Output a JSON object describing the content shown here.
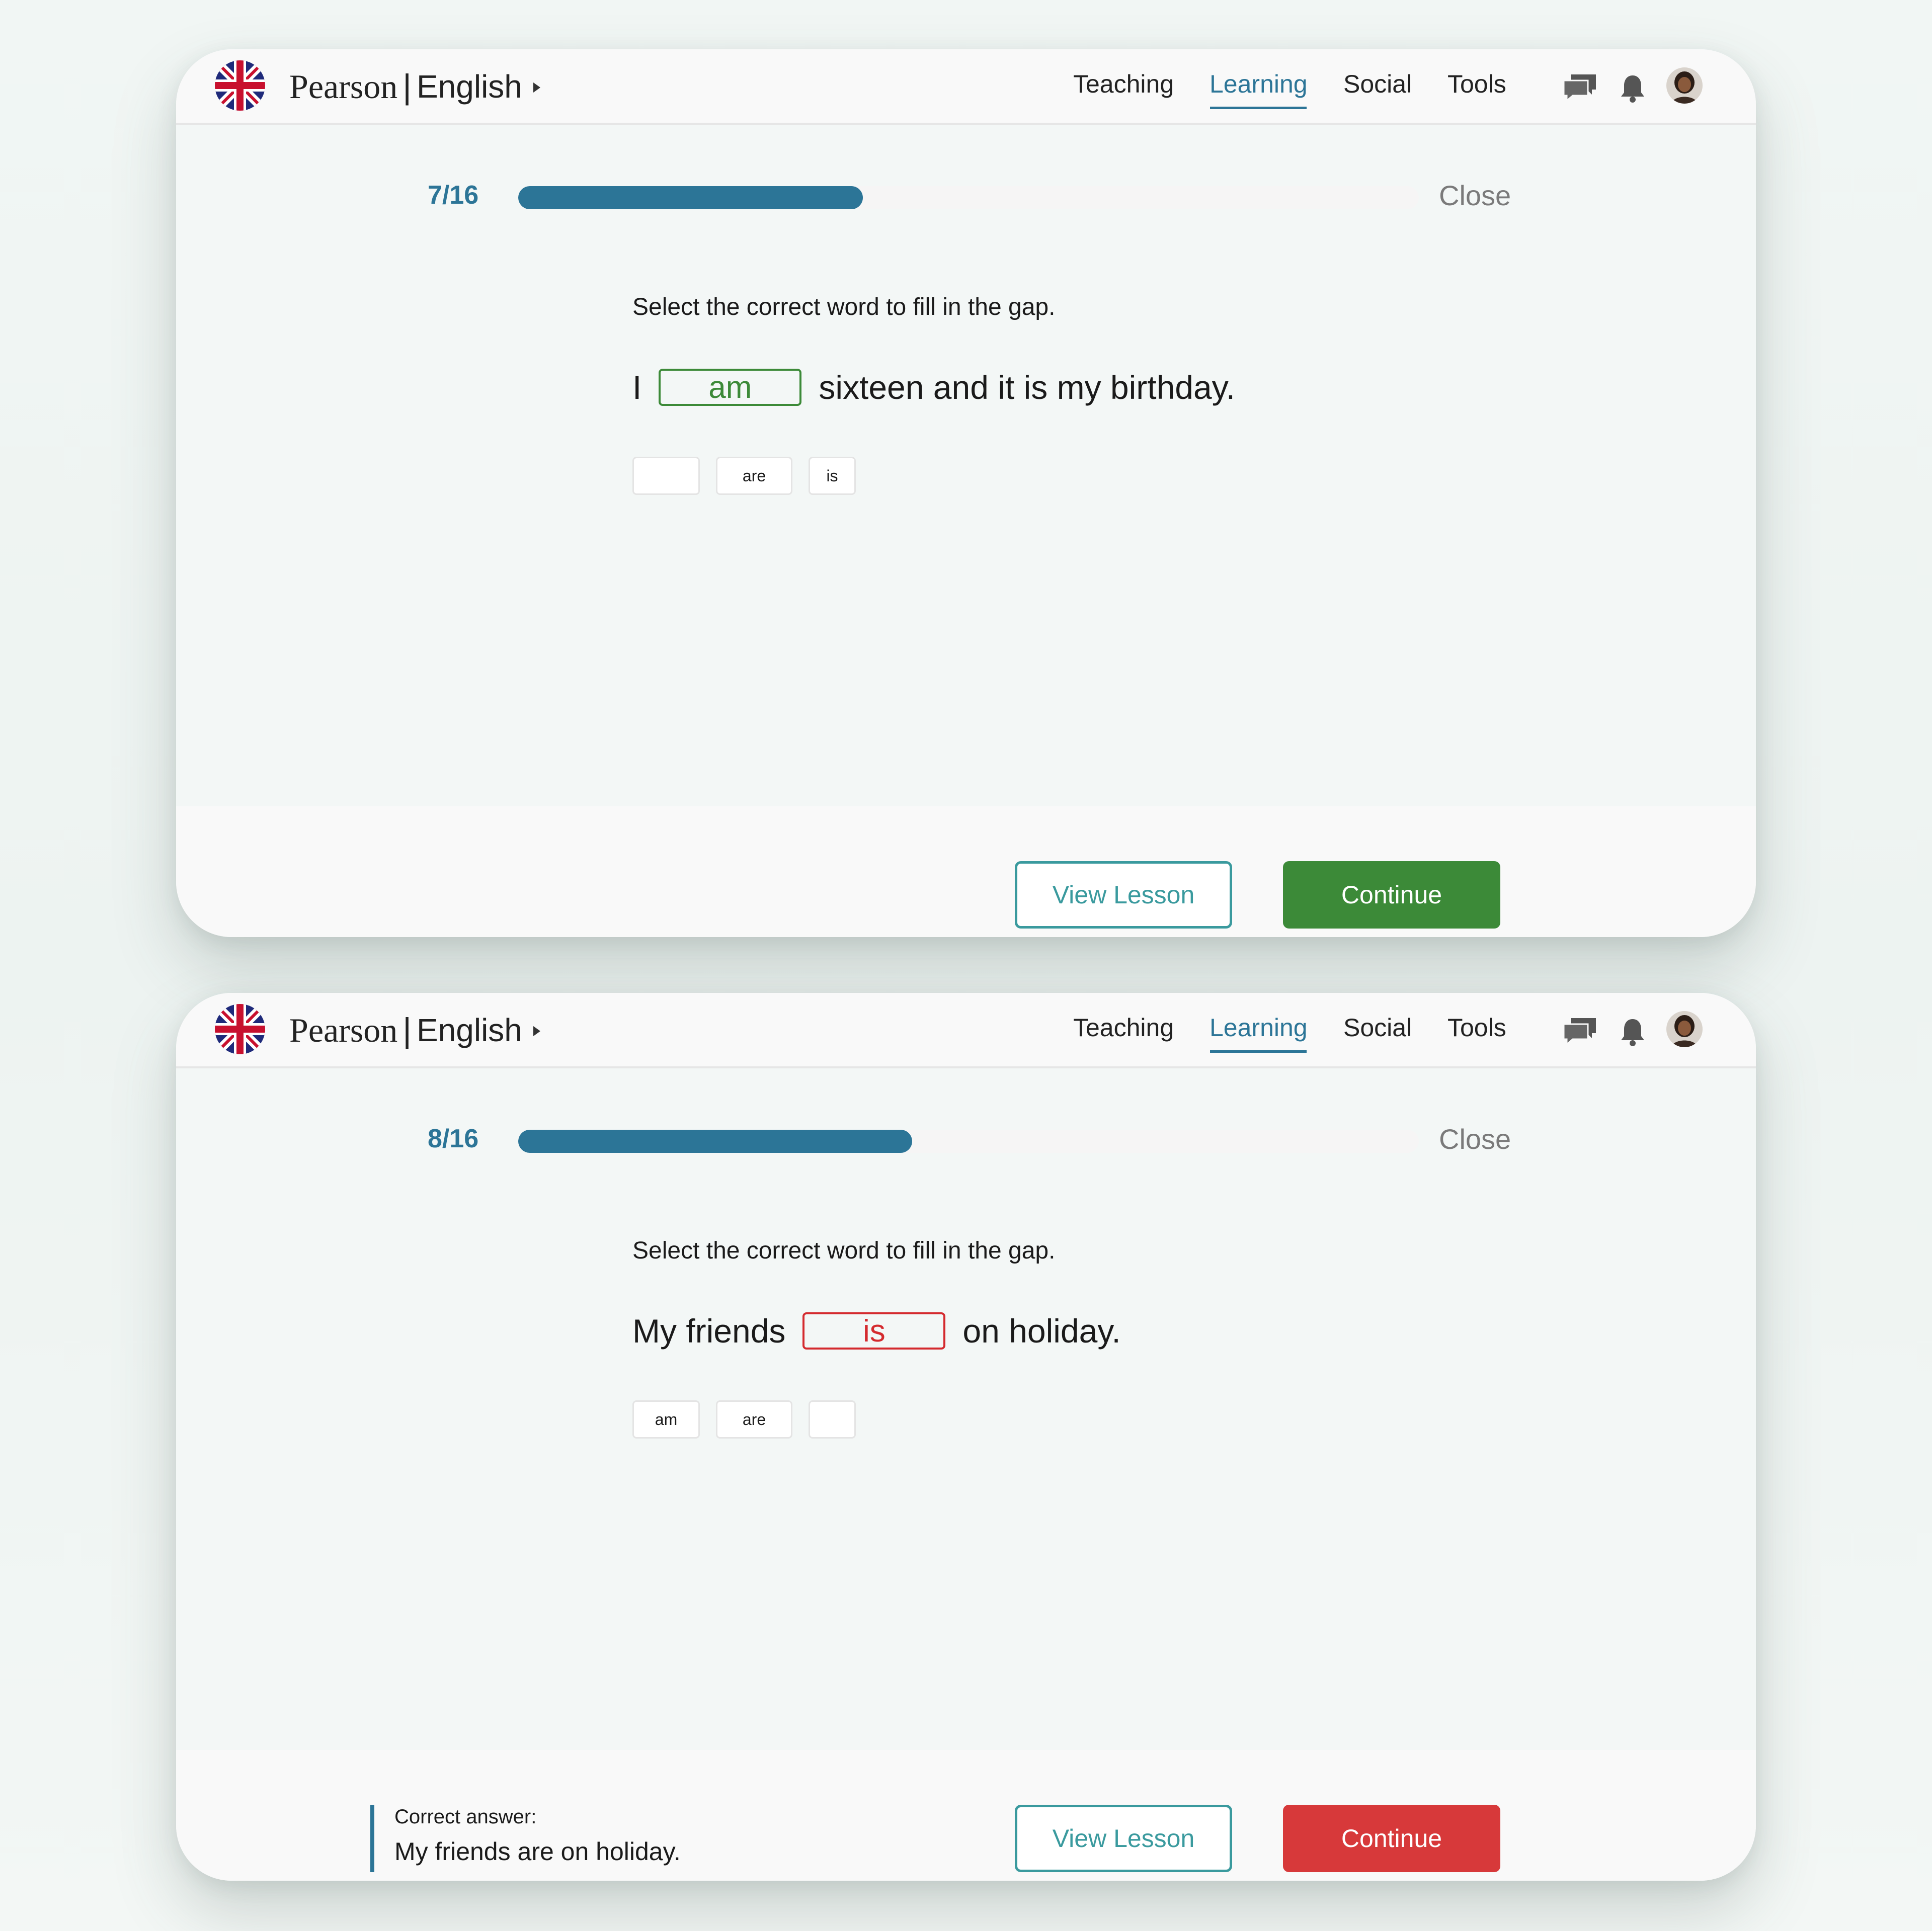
{
  "colors": {
    "accent": "#2c7597",
    "correct": "#3c8a38",
    "incorrect": "#d42a2e",
    "view_lesson": "#3a9a9e"
  },
  "screens": [
    {
      "header": {
        "brand_name": "Pearson",
        "separator": "|",
        "language": "English",
        "nav": {
          "teaching": "Teaching",
          "learning": "Learning",
          "social": "Social",
          "tools": "Tools"
        },
        "active_nav": "Learning"
      },
      "progress": {
        "label": "7/16",
        "current": 7,
        "total": 16,
        "close_label": "Close"
      },
      "question": {
        "instruction": "Select the correct word to fill in the gap.",
        "before": "I",
        "answer": "am",
        "after": "sixteen and it is my birthday.",
        "answer_state": "correct",
        "options": [
          "",
          "are",
          "is"
        ]
      },
      "footer": {
        "view_lesson_label": "View Lesson",
        "continue_label": "Continue",
        "continue_state": "correct"
      }
    },
    {
      "header": {
        "brand_name": "Pearson",
        "separator": "|",
        "language": "English",
        "nav": {
          "teaching": "Teaching",
          "learning": "Learning",
          "social": "Social",
          "tools": "Tools"
        },
        "active_nav": "Learning"
      },
      "progress": {
        "label": "8/16",
        "current": 8,
        "total": 16,
        "close_label": "Close"
      },
      "question": {
        "instruction": "Select the correct word to fill in the gap.",
        "before": "My friends",
        "answer": "is",
        "after": "on holiday.",
        "answer_state": "incorrect",
        "options": [
          "am",
          "are",
          ""
        ]
      },
      "footer": {
        "feedback_label": "Correct answer:",
        "feedback_text": "My friends are on holiday.",
        "view_lesson_label": "View Lesson",
        "continue_label": "Continue",
        "continue_state": "incorrect"
      }
    }
  ]
}
